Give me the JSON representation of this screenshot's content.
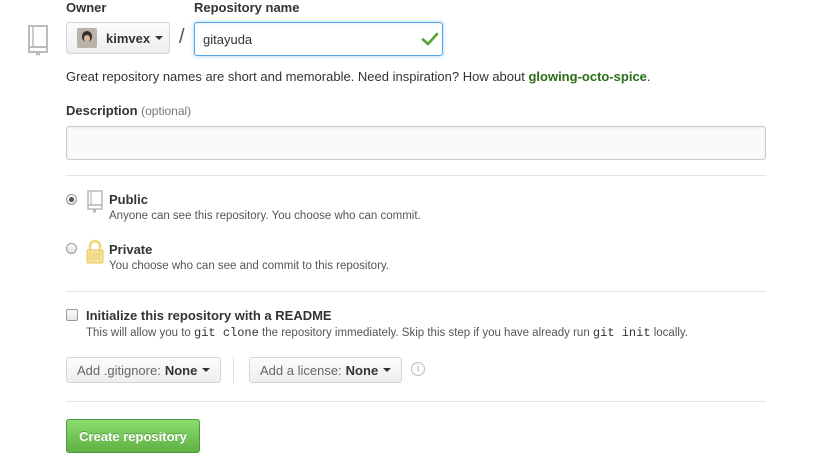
{
  "owner": {
    "label": "Owner",
    "username": "kimvex"
  },
  "repo_name": {
    "label": "Repository name",
    "value": "gitayuda",
    "separator": "/"
  },
  "hint": {
    "text": "Great repository names are short and memorable. Need inspiration? How about ",
    "suggestion": "glowing-octo-spice",
    "suffix": "."
  },
  "description": {
    "label": "Description",
    "optional": "(optional)",
    "value": ""
  },
  "visibility": {
    "public": {
      "title": "Public",
      "note": "Anyone can see this repository. You choose who can commit.",
      "selected": true
    },
    "private": {
      "title": "Private",
      "note": "You choose who can see and commit to this repository.",
      "selected": false
    }
  },
  "readme": {
    "title": "Initialize this repository with a README",
    "note_pre": "This will allow you to ",
    "code1": "git clone",
    "note_mid": " the repository immediately. Skip this step if you have already run ",
    "code2": "git init",
    "note_post": " locally.",
    "checked": false
  },
  "gitignore": {
    "label": "Add .gitignore:",
    "value": "None"
  },
  "license": {
    "label": "Add a license:",
    "value": "None"
  },
  "info_icon": "i",
  "create_button": "Create repository",
  "colors": {
    "accent_green": "#60b044",
    "suggestion_green": "#2a6e1a",
    "focus_blue": "#51a7e8"
  }
}
